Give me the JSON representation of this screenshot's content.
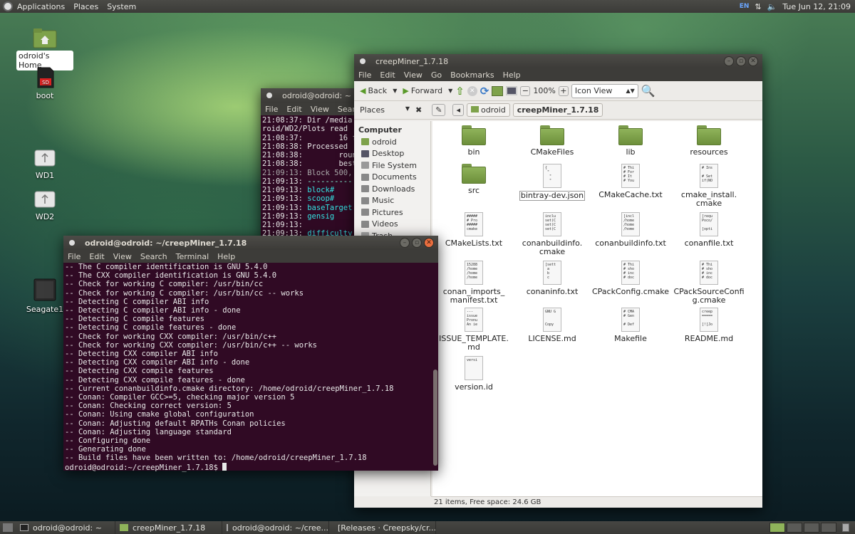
{
  "topbar": {
    "menus": [
      "Applications",
      "Places",
      "System"
    ],
    "lang": "EN",
    "datetime": "Tue Jun 12, 21:09"
  },
  "desktop": {
    "icons": [
      {
        "label": "odroid's Home",
        "icon": "home-folder-icon"
      },
      {
        "label": "boot",
        "icon": "sd-card-icon"
      },
      {
        "label": "WD1",
        "icon": "usb-drive-icon"
      },
      {
        "label": "WD2",
        "icon": "usb-drive-icon"
      },
      {
        "label": "Seagate1",
        "icon": "hard-drive-icon"
      }
    ]
  },
  "terminal_back": {
    "title": "odroid@odroid: ~",
    "menus": [
      "File",
      "Edit",
      "View",
      "Search"
    ],
    "lines": [
      "21:08:37: Dir /media",
      "roid/WD2/Plots read",
      "21:08:37:        16 f",
      "21:08:38: Processed",
      "21:08:38:        roun",
      "21:08:38:        best",
      "21:09:13: Block 500,",
      "21:09:13: ----------",
      "21:09:13: block#",
      "21:09:13: scoop#",
      "21:09:13: baseTarget",
      "21:09:13: gensig",
      "21:09:13:",
      "21:09:13: difficulty"
    ]
  },
  "terminal_front": {
    "title": "odroid@odroid: ~/creepMiner_1.7.18",
    "menus": [
      "File",
      "Edit",
      "View",
      "Search",
      "Terminal",
      "Help"
    ],
    "lines": [
      "-- The C compiler identification is GNU 5.4.0",
      "-- The CXX compiler identification is GNU 5.4.0",
      "-- Check for working C compiler: /usr/bin/cc",
      "-- Check for working C compiler: /usr/bin/cc -- works",
      "-- Detecting C compiler ABI info",
      "-- Detecting C compiler ABI info - done",
      "-- Detecting C compile features",
      "-- Detecting C compile features - done",
      "-- Check for working CXX compiler: /usr/bin/c++",
      "-- Check for working CXX compiler: /usr/bin/c++ -- works",
      "-- Detecting CXX compiler ABI info",
      "-- Detecting CXX compiler ABI info - done",
      "-- Detecting CXX compile features",
      "-- Detecting CXX compile features - done",
      "-- Current conanbuildinfo.cmake directory: /home/odroid/creepMiner_1.7.18",
      "-- Conan: Compiler GCC>=5, checking major version 5",
      "-- Conan: Checking correct version: 5",
      "-- Conan: Using cmake global configuration",
      "-- Conan: Adjusting default RPATHs Conan policies",
      "-- Conan: Adjusting language standard",
      "-- Configuring done",
      "-- Generating done",
      "-- Build files have been written to: /home/odroid/creepMiner_1.7.18"
    ],
    "prompt": "odroid@odroid:~/creepMiner_1.7.18$ "
  },
  "filemanager": {
    "title": "creepMiner_1.7.18",
    "menus": [
      "File",
      "Edit",
      "View",
      "Go",
      "Bookmarks",
      "Help"
    ],
    "toolbar": {
      "back": "Back",
      "forward": "Forward",
      "zoom": "100%",
      "view_mode": "Icon View"
    },
    "places_label": "Places",
    "breadcrumbs": [
      "odroid",
      "creepMiner_1.7.18"
    ],
    "sidebar": {
      "header": "Computer",
      "items": [
        "odroid",
        "Desktop",
        "File System",
        "Documents",
        "Downloads",
        "Music",
        "Pictures",
        "Videos",
        "Trash"
      ]
    },
    "files": [
      {
        "name": "bin",
        "type": "folder"
      },
      {
        "name": "CMakeFiles",
        "type": "folder"
      },
      {
        "name": "lib",
        "type": "folder"
      },
      {
        "name": "resources",
        "type": "folder"
      },
      {
        "name": "src",
        "type": "folder"
      },
      {
        "name": "bintray-dev.json",
        "type": "doc",
        "preview": "{\n \"\n  \"\n  \""
      },
      {
        "name": "CMakeCache.txt",
        "type": "doc",
        "preview": "# Thi\n# For\n# It\n# You"
      },
      {
        "name": "cmake_install.\ncmake",
        "type": "doc",
        "preview": "# Ins\n\n# Set\nif(NO"
      },
      {
        "name": "CMakeLists.txt",
        "type": "doc",
        "preview": "#####\n# Pro\n#####\ncmake"
      },
      {
        "name": "conanbuildinfo.\ncmake",
        "type": "doc",
        "preview": "inclu\nset(C\nset(C\nset(C"
      },
      {
        "name": "conanbuildinfo.txt",
        "type": "doc",
        "preview": "[incl\n/home\n/home\n/home"
      },
      {
        "name": "conanfile.txt",
        "type": "doc",
        "preview": "[requ\nPoco/\n\n[opti"
      },
      {
        "name": "conan_imports_\nmanifest.txt",
        "type": "doc",
        "preview": "15288\n/home\n/home\n/home"
      },
      {
        "name": "conaninfo.txt",
        "type": "doc",
        "preview": "[sett\n a\n b\n c"
      },
      {
        "name": "CPackConfig.cmake",
        "type": "doc",
        "preview": "# Thi\n# sho\n# inc\n# doc"
      },
      {
        "name": "CPackSourceConfi\ng.cmake",
        "type": "doc",
        "preview": "# Thi\n# sho\n# inc\n# doc"
      },
      {
        "name": "ISSUE_TEMPLATE.\nmd",
        "type": "doc",
        "preview": "---\nissue\nPronu\nAn ie"
      },
      {
        "name": "LICENSE.md",
        "type": "doc",
        "preview": "GNU G\n\n\nCopy"
      },
      {
        "name": "Makefile",
        "type": "doc",
        "preview": "# CMA\n# Gen\n\n# Def"
      },
      {
        "name": "README.md",
        "type": "doc",
        "preview": "creep\n=====\n\n[![Jo"
      },
      {
        "name": "version.id",
        "type": "doc",
        "preview": "versi"
      }
    ],
    "status": "21 items, Free space: 24.6 GB"
  },
  "taskbar": {
    "tasks": [
      {
        "label": "odroid@odroid: ~",
        "icon": "terminal-icon"
      },
      {
        "label": "creepMiner_1.7.18",
        "icon": "folder-icon"
      },
      {
        "label": "odroid@odroid: ~/cree...",
        "icon": "terminal-icon"
      },
      {
        "label": "[Releases · Creepsky/cr...",
        "icon": "browser-icon"
      }
    ]
  },
  "colors": {
    "terminal_bg": "#300a24",
    "terminal_highlight": "#34e2e2",
    "folder_green": "#8fb35a",
    "close_orange": "#ea6e3f"
  }
}
